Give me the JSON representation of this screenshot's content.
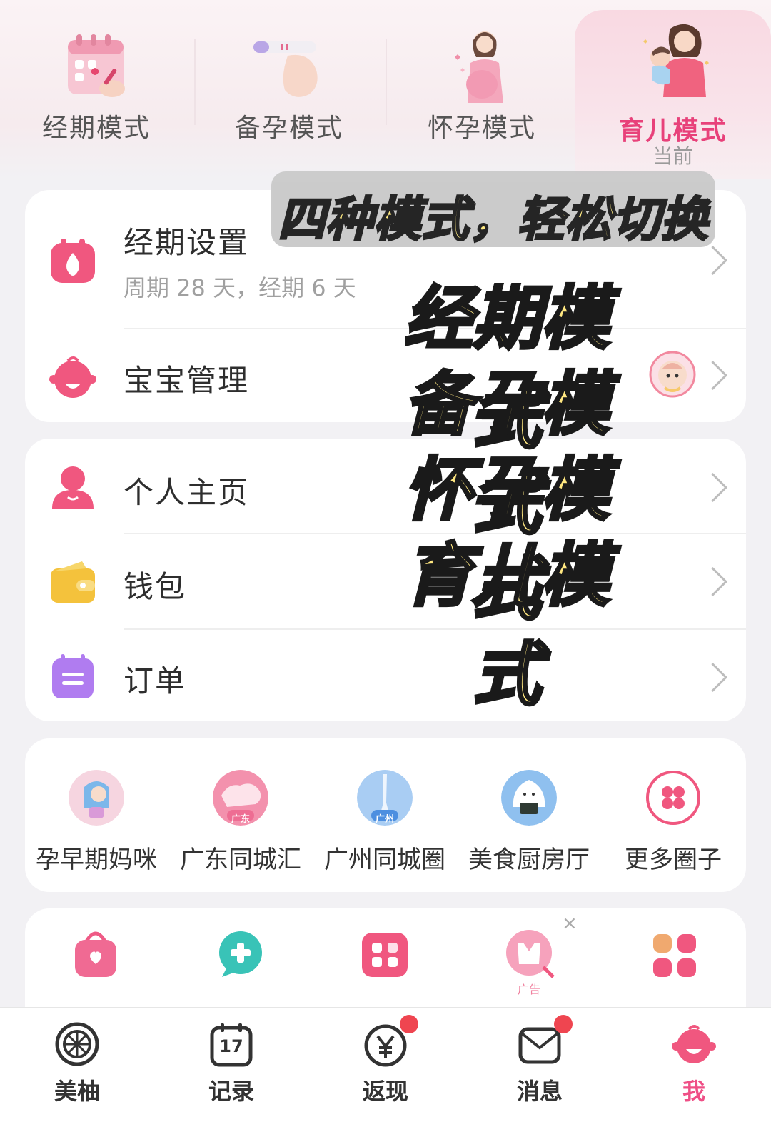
{
  "modes": [
    {
      "label": "经期模式",
      "sub": ""
    },
    {
      "label": "备孕模式",
      "sub": ""
    },
    {
      "label": "怀孕模式",
      "sub": ""
    },
    {
      "label": "育儿模式",
      "sub": "当前"
    }
  ],
  "overlay": {
    "banner": "四种模式，轻松切换",
    "labels": [
      "经期模式",
      "备孕模式",
      "怀孕模式",
      "育儿模式"
    ]
  },
  "settings_card": {
    "period_title": "经期设置",
    "period_desc": "周期 28 天，经期 6 天",
    "baby_title": "宝宝管理"
  },
  "account_card": {
    "profile": "个人主页",
    "wallet": "钱包",
    "orders": "订单"
  },
  "circles": [
    {
      "name": "孕早期妈咪",
      "badge": ""
    },
    {
      "name": "广东同城汇",
      "badge": "广东"
    },
    {
      "name": "广州同城圈",
      "badge": "广州"
    },
    {
      "name": "美食厨房厅",
      "badge": ""
    },
    {
      "name": "更多圈子",
      "badge": ""
    }
  ],
  "services": {
    "ad_label": "广告",
    "close": "×"
  },
  "nav": [
    {
      "label": "美柚",
      "icon": "grapefruit-icon"
    },
    {
      "label": "记录",
      "icon": "calendar-icon",
      "day": "17"
    },
    {
      "label": "返现",
      "icon": "yuan-icon"
    },
    {
      "label": "消息",
      "icon": "envelope-icon"
    },
    {
      "label": "我",
      "icon": "baby-face-icon"
    }
  ],
  "colors": {
    "accent": "#ef4f86",
    "sticker": "#ffe780",
    "badge_dot": "#ef4550"
  }
}
